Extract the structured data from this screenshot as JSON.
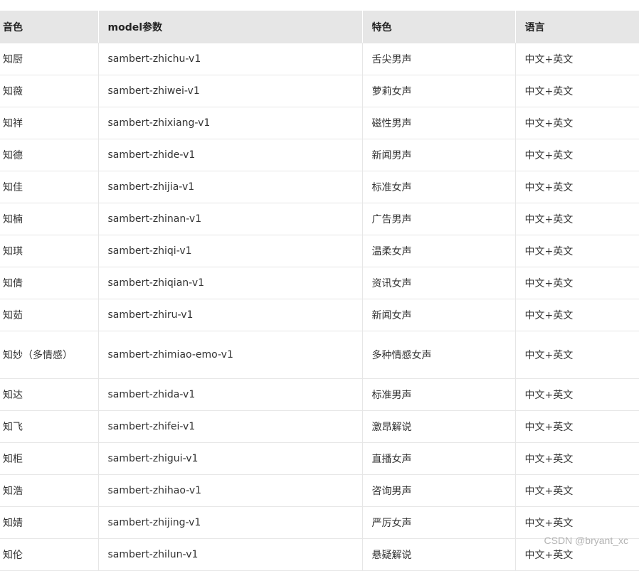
{
  "table": {
    "headers": [
      "音色",
      "model参数",
      "特色",
      "语言"
    ],
    "rows": [
      [
        "知厨",
        "sambert-zhichu-v1",
        "舌尖男声",
        "中文+英文"
      ],
      [
        "知薇",
        "sambert-zhiwei-v1",
        "萝莉女声",
        "中文+英文"
      ],
      [
        "知祥",
        "sambert-zhixiang-v1",
        "磁性男声",
        "中文+英文"
      ],
      [
        "知德",
        "sambert-zhide-v1",
        "新闻男声",
        "中文+英文"
      ],
      [
        "知佳",
        "sambert-zhijia-v1",
        "标准女声",
        "中文+英文"
      ],
      [
        "知楠",
        "sambert-zhinan-v1",
        "广告男声",
        "中文+英文"
      ],
      [
        "知琪",
        "sambert-zhiqi-v1",
        "温柔女声",
        "中文+英文"
      ],
      [
        "知倩",
        "sambert-zhiqian-v1",
        "资讯女声",
        "中文+英文"
      ],
      [
        "知茹",
        "sambert-zhiru-v1",
        "新闻女声",
        "中文+英文"
      ],
      [
        "知妙（多情感）",
        "sambert-zhimiao-emo-v1",
        "多种情感女声",
        "中文+英文"
      ],
      [
        "知达",
        "sambert-zhida-v1",
        "标准男声",
        "中文+英文"
      ],
      [
        "知飞",
        "sambert-zhifei-v1",
        "激昂解说",
        "中文+英文"
      ],
      [
        "知柜",
        "sambert-zhigui-v1",
        "直播女声",
        "中文+英文"
      ],
      [
        "知浩",
        "sambert-zhihao-v1",
        "咨询男声",
        "中文+英文"
      ],
      [
        "知婧",
        "sambert-zhijing-v1",
        "严厉女声",
        "中文+英文"
      ],
      [
        "知伦",
        "sambert-zhilun-v1",
        "悬疑解说",
        "中文+英文"
      ]
    ]
  },
  "watermark": "CSDN @bryant_xc"
}
